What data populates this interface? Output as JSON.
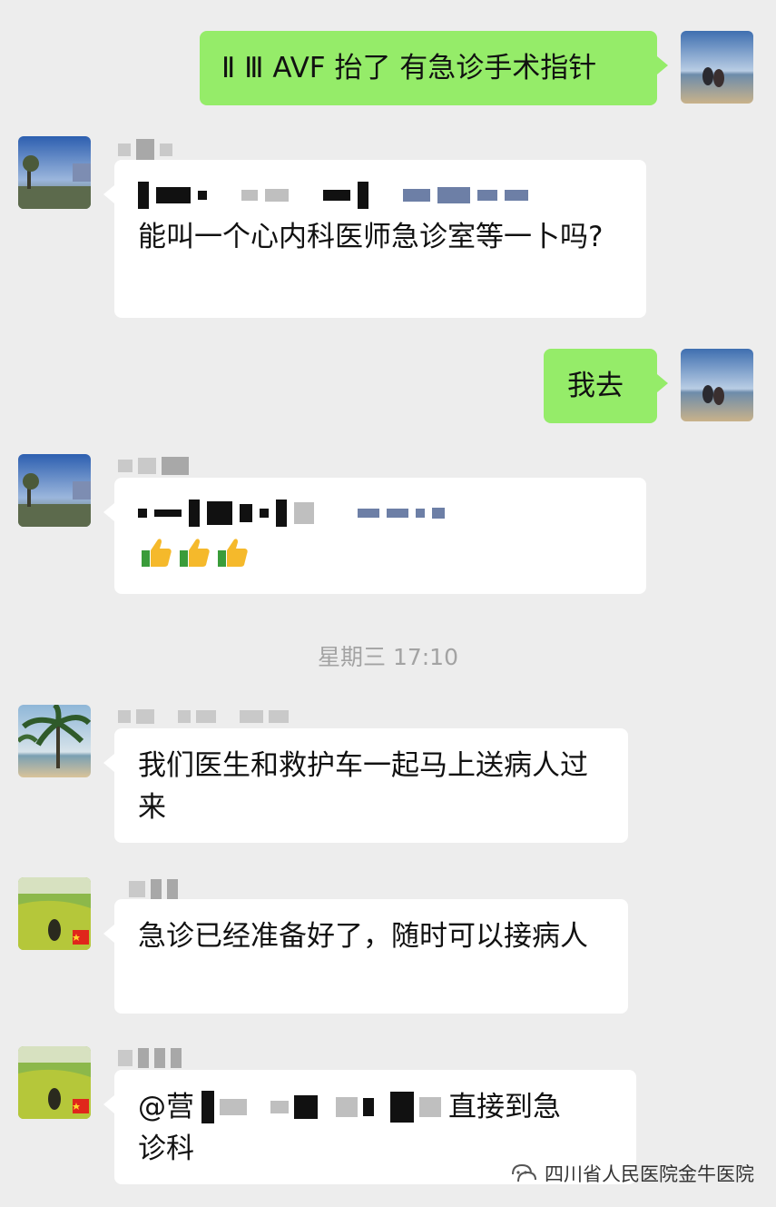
{
  "messages": [
    {
      "side": "right",
      "text": "Ⅱ Ⅲ AVF 抬了 有急诊手术指针"
    },
    {
      "side": "left",
      "line1_redacted": true,
      "text": "能叫一个心内科医师急诊室等一卜吗?"
    },
    {
      "side": "right",
      "text": "我去"
    },
    {
      "side": "left",
      "line1_redacted": true,
      "emoji": "👍👍👍"
    },
    {
      "side": "left",
      "text": "我们医生和救护车一起马上送病人过来"
    },
    {
      "side": "left",
      "text": "急诊已经准备好了，随时可以接病人"
    },
    {
      "side": "left",
      "text_prefix": "@营",
      "text_suffix": "直接到急",
      "text_line2": "诊科"
    }
  ],
  "timestamp": "星期三 17:10",
  "watermark": "四川省人民医院金牛医院",
  "icons": {
    "watermark": "wechat-channel-icon",
    "thumbs": "thumbs-up-icon"
  },
  "colors": {
    "background": "#ededed",
    "bubble_sent": "#95ec69",
    "bubble_received": "#ffffff",
    "timestamp": "#a3a3a3"
  }
}
